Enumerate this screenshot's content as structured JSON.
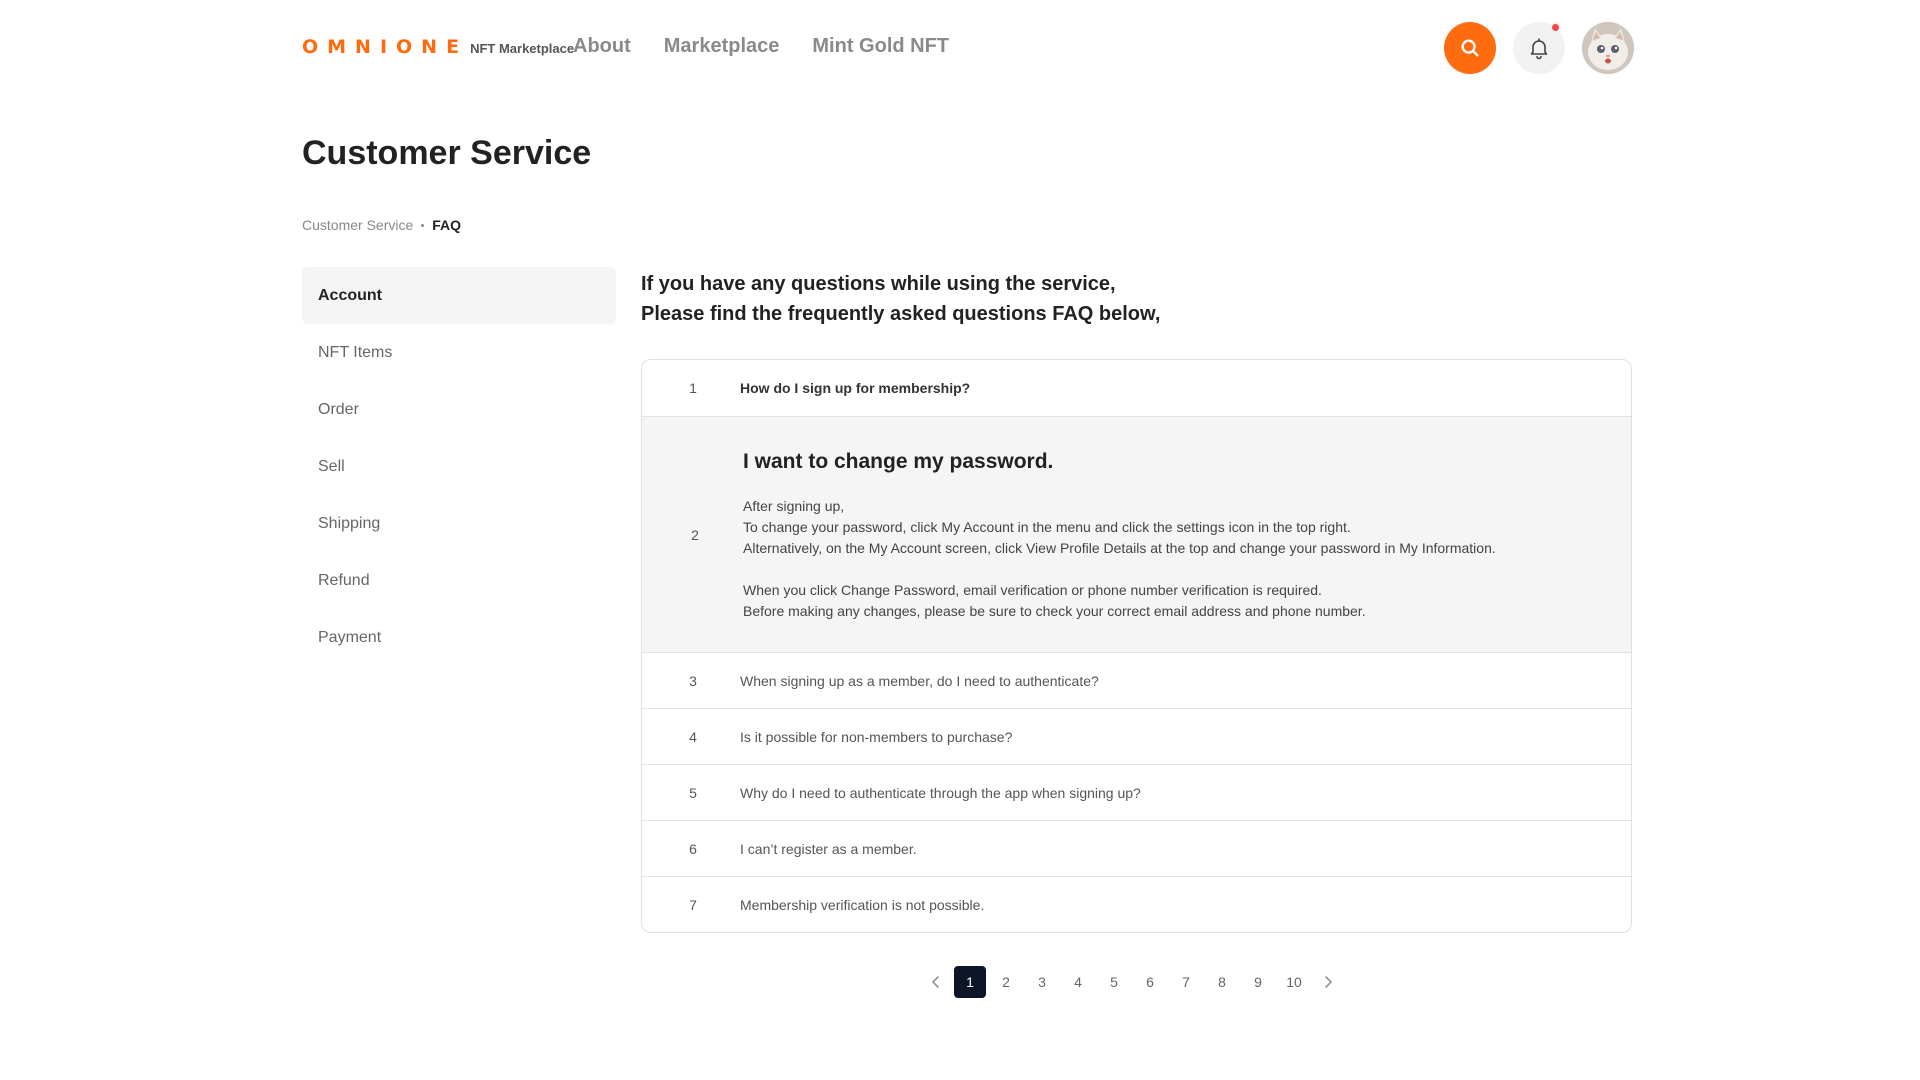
{
  "header": {
    "logo_word": "OMNIONE",
    "logo_sub": "NFT Marketplace",
    "nav": [
      "About",
      "Marketplace",
      "Mint Gold NFT"
    ]
  },
  "page": {
    "title": "Customer Service",
    "breadcrumb": [
      "Customer Service",
      "FAQ"
    ]
  },
  "sidebar": {
    "items": [
      "Account",
      "NFT Items",
      "Order",
      "Sell",
      "Shipping",
      "Refund",
      "Payment"
    ],
    "active": "Account"
  },
  "intro": {
    "line1": "If you have any questions while using the service,",
    "line2": "Please find the frequently asked questions FAQ below,"
  },
  "faq": {
    "items": [
      {
        "num": "1",
        "question": "How do I sign up for membership?"
      },
      {
        "num": "2",
        "question": "I want to change my password."
      },
      {
        "num": "3",
        "question": "When signing up as a member, do I need to authenticate?"
      },
      {
        "num": "4",
        "question": "Is it possible for non-members to purchase?"
      },
      {
        "num": "5",
        "question": "Why do I need to authenticate through the app when signing up?"
      },
      {
        "num": "6",
        "question": "I can’t register as a member."
      },
      {
        "num": "7",
        "question": "Membership verification is not possible."
      }
    ],
    "open_answer": [
      "After signing up,",
      "To change your password, click My Account in the menu and click the settings icon in the top right.",
      "Alternatively, on the My Account screen, click View Profile Details at the top and change your password in My Information.",
      "",
      "When you click Change Password, email verification or phone number verification is required.",
      "Before making any changes, please be sure to check your correct email address and phone number."
    ]
  },
  "pagination": {
    "pages": [
      "1",
      "2",
      "3",
      "4",
      "5",
      "6",
      "7",
      "8",
      "9",
      "10"
    ],
    "current": "1"
  },
  "colors": {
    "brand": "#ff6b0f",
    "notification_dot": "#f2464a",
    "active_page": "#0d1629"
  },
  "icons": {
    "search": "search-icon",
    "bell": "bell-icon",
    "avatar": "cat-avatar",
    "prev": "chevron-left-icon",
    "next": "chevron-right-icon"
  }
}
